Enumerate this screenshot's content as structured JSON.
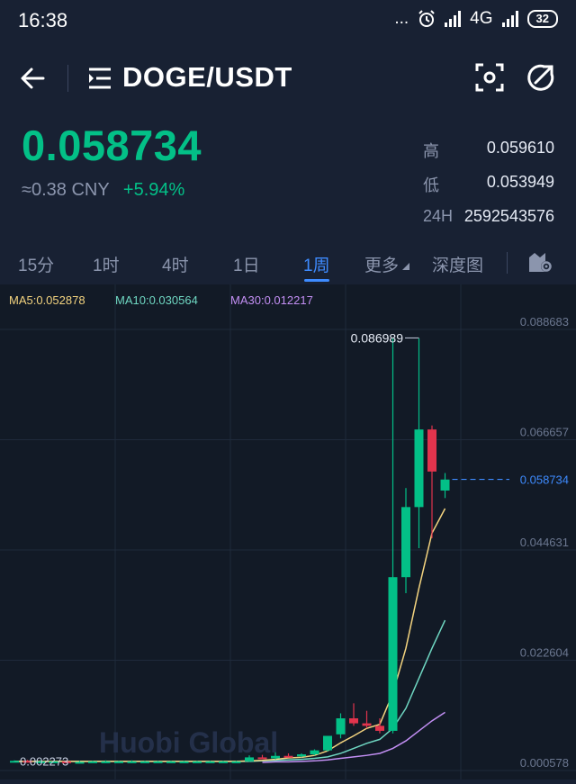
{
  "status_bar": {
    "time": "16:38",
    "dots": "...",
    "network": "4G",
    "battery": "32"
  },
  "header": {
    "pair": "DOGE/USDT"
  },
  "price": {
    "last": "0.058734",
    "cny": "≈0.38 CNY",
    "change": "+5.94%"
  },
  "stats": [
    {
      "label": "高",
      "value": "0.059610"
    },
    {
      "label": "低",
      "value": "0.053949"
    },
    {
      "label": "24H",
      "value": "2592543576"
    }
  ],
  "tabs": [
    "15分",
    "1时",
    "4时",
    "1日",
    "1周",
    "更多",
    "深度图"
  ],
  "active_tab": "1周",
  "colors": {
    "up": "#03c087",
    "down": "#e2344d",
    "accent": "#3e8bff",
    "ma5": "#f4d47f",
    "ma10": "#6fd7c2",
    "ma30": "#c38ff4"
  },
  "chart_data": {
    "type": "candlestick",
    "legend": [
      {
        "name": "MA5",
        "label": "MA5:0.052878"
      },
      {
        "name": "MA10",
        "label": "MA10:0.030564"
      },
      {
        "name": "MA30",
        "label": "MA30:0.012217"
      }
    ],
    "y_ticks": [
      "0.088683",
      "0.066657",
      "0.044631",
      "0.022604",
      "0.000578"
    ],
    "ylim": [
      0.000578,
      0.088683
    ],
    "current_price_label": "0.058734",
    "current_price": 0.058734,
    "max_label": "0.086989",
    "max_value": 0.086989,
    "min_label": "0.002273",
    "min_value": 0.002273,
    "watermark": "Huobi Global",
    "candles": [
      {
        "o": 0.0024,
        "h": 0.0026,
        "l": 0.0022,
        "c": 0.0025
      },
      {
        "o": 0.0025,
        "h": 0.0027,
        "l": 0.0023,
        "c": 0.0024
      },
      {
        "o": 0.0024,
        "h": 0.0026,
        "l": 0.0023,
        "c": 0.0024
      },
      {
        "o": 0.0024,
        "h": 0.0025,
        "l": 0.0023,
        "c": 0.0024
      },
      {
        "o": 0.0024,
        "h": 0.0026,
        "l": 0.0023,
        "c": 0.0023
      },
      {
        "o": 0.0023,
        "h": 0.0025,
        "l": 0.0022,
        "c": 0.0023
      },
      {
        "o": 0.0023,
        "h": 0.0025,
        "l": 0.0022,
        "c": 0.0024
      },
      {
        "o": 0.0024,
        "h": 0.0026,
        "l": 0.0023,
        "c": 0.0024
      },
      {
        "o": 0.0024,
        "h": 0.0025,
        "l": 0.0023,
        "c": 0.0024
      },
      {
        "o": 0.0024,
        "h": 0.0026,
        "l": 0.0023,
        "c": 0.0024
      },
      {
        "o": 0.0024,
        "h": 0.0025,
        "l": 0.0023,
        "c": 0.0024
      },
      {
        "o": 0.0024,
        "h": 0.0025,
        "l": 0.0023,
        "c": 0.0024
      },
      {
        "o": 0.0024,
        "h": 0.0025,
        "l": 0.0023,
        "c": 0.0024
      },
      {
        "o": 0.0024,
        "h": 0.0025,
        "l": 0.0023,
        "c": 0.0024
      },
      {
        "o": 0.0024,
        "h": 0.0025,
        "l": 0.0023,
        "c": 0.0024
      },
      {
        "o": 0.0024,
        "h": 0.0025,
        "l": 0.0023,
        "c": 0.0024
      },
      {
        "o": 0.0024,
        "h": 0.0025,
        "l": 0.0023,
        "c": 0.0024
      },
      {
        "o": 0.0024,
        "h": 0.0025,
        "l": 0.0023,
        "c": 0.0024
      },
      {
        "o": 0.0024,
        "h": 0.0036,
        "l": 0.0023,
        "c": 0.0032
      },
      {
        "o": 0.0032,
        "h": 0.0037,
        "l": 0.0029,
        "c": 0.003
      },
      {
        "o": 0.003,
        "h": 0.0042,
        "l": 0.0028,
        "c": 0.0035
      },
      {
        "o": 0.0035,
        "h": 0.004,
        "l": 0.0032,
        "c": 0.0034
      },
      {
        "o": 0.0034,
        "h": 0.004,
        "l": 0.0032,
        "c": 0.0038
      },
      {
        "o": 0.0038,
        "h": 0.0048,
        "l": 0.0036,
        "c": 0.0046
      },
      {
        "o": 0.0046,
        "h": 0.007,
        "l": 0.0044,
        "c": 0.0075
      },
      {
        "o": 0.0078,
        "h": 0.012,
        "l": 0.007,
        "c": 0.011
      },
      {
        "o": 0.011,
        "h": 0.014,
        "l": 0.0095,
        "c": 0.01
      },
      {
        "o": 0.01,
        "h": 0.0125,
        "l": 0.009,
        "c": 0.0095
      },
      {
        "o": 0.0095,
        "h": 0.011,
        "l": 0.008,
        "c": 0.0085
      },
      {
        "o": 0.0085,
        "h": 0.0869,
        "l": 0.008,
        "c": 0.0392
      },
      {
        "o": 0.0392,
        "h": 0.057,
        "l": 0.036,
        "c": 0.0532
      },
      {
        "o": 0.0532,
        "h": 0.0869,
        "l": 0.045,
        "c": 0.0687
      },
      {
        "o": 0.0687,
        "h": 0.0695,
        "l": 0.047,
        "c": 0.0603
      },
      {
        "o": 0.0565,
        "h": 0.06,
        "l": 0.055,
        "c": 0.0587
      }
    ],
    "ma5": [
      0.0024,
      0.0024,
      0.0024,
      0.0024,
      0.0024,
      0.0024,
      0.0024,
      0.0024,
      0.0024,
      0.0024,
      0.0024,
      0.0024,
      0.0024,
      0.0024,
      0.0024,
      0.0024,
      0.0024,
      0.0024,
      0.0025,
      0.0026,
      0.0028,
      0.0031,
      0.0032,
      0.0036,
      0.0045,
      0.0061,
      0.0075,
      0.009,
      0.0098,
      0.016,
      0.025,
      0.037,
      0.048,
      0.0529
    ],
    "ma10": [
      0.0024,
      0.0024,
      0.0024,
      0.0024,
      0.0024,
      0.0024,
      0.0024,
      0.0024,
      0.0024,
      0.0024,
      0.0024,
      0.0024,
      0.0024,
      0.0024,
      0.0024,
      0.0024,
      0.0024,
      0.0024,
      0.0024,
      0.0025,
      0.0026,
      0.0027,
      0.0028,
      0.003,
      0.0033,
      0.004,
      0.005,
      0.006,
      0.0068,
      0.009,
      0.013,
      0.019,
      0.025,
      0.0306
    ],
    "ma30": [
      null,
      null,
      null,
      null,
      null,
      null,
      null,
      null,
      null,
      null,
      null,
      null,
      null,
      null,
      null,
      null,
      null,
      null,
      null,
      0.0022,
      0.0023,
      0.0023,
      0.0024,
      0.0025,
      0.0027,
      0.003,
      0.0033,
      0.0036,
      0.004,
      0.005,
      0.0065,
      0.0085,
      0.0105,
      0.0122
    ]
  }
}
